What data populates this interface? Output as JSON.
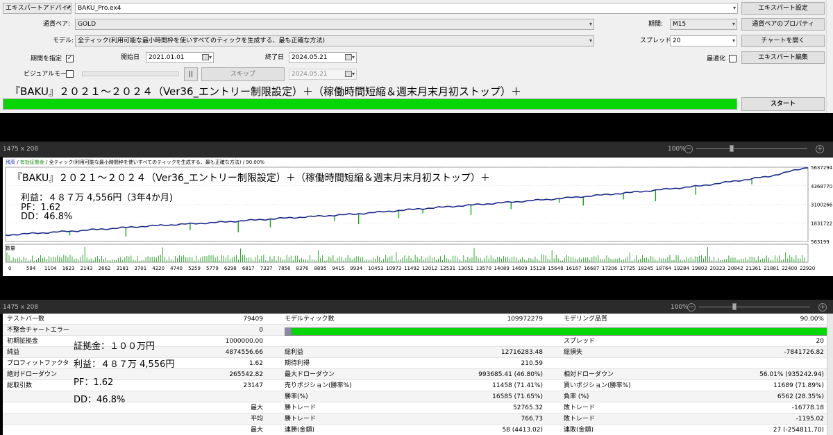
{
  "settings": {
    "expert_select": "エキスパートアドバイザ",
    "expert_file": "BAKU_Pro.ex4",
    "btn_expert_settings": "エキスパート設定",
    "symbol_label": "通貨ペア:",
    "symbol_value": "GOLD",
    "period_label": "期間:",
    "period_value": "M15",
    "btn_symbol_props": "通貨ペアのプロパティ",
    "model_label": "モデル:",
    "model_value": "全ティック(利用可能な最小時間枠を使いすべてのティックを生成する、最も正確な方法)",
    "spread_label": "スプレッド:",
    "spread_value": "20",
    "btn_open_chart": "チャートを開く",
    "use_date_label": "期間を指定",
    "use_date_checked": "✓",
    "start_label": "開始日",
    "start_value": "2021.01.01",
    "end_label": "終了日",
    "end_value": "2024.05.21",
    "optimize_label": "最適化",
    "btn_edit_expert": "エキスパート編集",
    "visual_label": "ビジュアルモード",
    "pause_btn": "||",
    "skip_btn": "スキップ",
    "skip_date": "2024.05.21",
    "headline": "『BAKU』２０２１～２０２４（Ver36_エントリー制限設定）＋（稼働時間短縮＆週末月末月初ストップ）＋",
    "progress": 1.0,
    "btn_start": "スタート"
  },
  "chart_window": {
    "size_text": "1475 x 208",
    "zoom_text": "100%",
    "minus": "−",
    "plus": "+"
  },
  "report_window": {
    "size_text": "1475 x 208",
    "zoom_text": "100%",
    "minus": "−",
    "plus": "+"
  },
  "chart_data": {
    "type": "line",
    "title_parts": {
      "balance": "残高",
      "equity": "有効証拠金",
      "desc": "全ティック(利用可能な最小時間枠を使いすべてのティックを生成する、最も正確な方法)",
      "quality": "90.00%"
    },
    "overlay_headline": "『BAKU』２０２１～２０２４（Ver36_エントリー制限設定）＋（稼働時間短縮＆週末月末月初ストップ）＋",
    "overlay_profit": "利益：４８７万 4,556円（3年4か月)",
    "overlay_pf": "PF：1.62",
    "overlay_dd": "DD：46.8%",
    "volume_label": "数量",
    "ylim": [
      563199,
      5637294
    ],
    "yticks": [
      "5637294",
      "4368770",
      "3100266",
      "1831722",
      "563199"
    ],
    "xticks": [
      "0",
      "584",
      "1104",
      "1623",
      "2143",
      "2662",
      "3181",
      "3701",
      "4220",
      "4740",
      "5259",
      "5779",
      "6298",
      "6817",
      "7337",
      "7856",
      "8376",
      "8895",
      "9415",
      "9934",
      "10453",
      "10973",
      "11492",
      "12012",
      "12531",
      "13051",
      "13570",
      "14089",
      "14609",
      "15128",
      "15648",
      "16167",
      "16687",
      "17206",
      "17725",
      "18245",
      "18764",
      "19284",
      "19803",
      "20323",
      "20842",
      "21361",
      "21881",
      "22400",
      "22920"
    ],
    "series": [
      {
        "name": "残高",
        "x": [
          0,
          2000,
          4000,
          6000,
          8000,
          10000,
          12000,
          14000,
          16000,
          18000,
          20000,
          22000,
          23147
        ],
        "y": [
          1000000,
          1280000,
          1600000,
          1850000,
          2150000,
          2420000,
          2800000,
          3150000,
          3500000,
          3900000,
          4350000,
          5000000,
          5637294
        ]
      }
    ]
  },
  "report": {
    "rows": [
      [
        "テストバー数",
        "79409",
        "モデルティック数",
        "109972279",
        "モデリング品質",
        "90.00%"
      ],
      [
        "不整合チャートエラー",
        "0",
        "",
        "",
        "",
        ""
      ],
      [
        "初期証拠金",
        "1000000.00",
        "",
        "",
        "スプレッド",
        "20"
      ],
      [
        "純益",
        "4874556.66",
        "総利益",
        "12716283.48",
        "総損失",
        "-7841726.82"
      ],
      [
        "プロフィットファクタ",
        "1.62",
        "期待利得",
        "210.59",
        "",
        ""
      ],
      [
        "絶対ドローダウン",
        "265542.82",
        "最大ドローダウン",
        "993685.41 (46.80%)",
        "相対ドローダウン",
        "56.01% (935242.94)"
      ],
      [
        "総取引数",
        "23147",
        "売りポジション(勝率%)",
        "11458 (71.41%)",
        "買いポジション(勝率%)",
        "11689 (71.89%)"
      ],
      [
        "",
        "",
        "勝率(%)",
        "16585 (71.65%)",
        "負率 (%)",
        "6562 (28.35%)"
      ],
      [
        "",
        "最大",
        "勝トレード",
        "52765.32",
        "敗トレード",
        "-16778.18"
      ],
      [
        "",
        "平均",
        "勝トレード",
        "766.73",
        "敗トレード",
        "-1195.02"
      ],
      [
        "",
        "最大",
        "連勝(金額)",
        "58 (4413.02)",
        "連敗(金額)",
        "27 (-254811.70)"
      ]
    ],
    "note_margin": "証拠金：１００万円",
    "note_profit": "利益：４８７万 4,556円",
    "note_pf": "PF：1.62",
    "note_dd": "DD：46.8%"
  },
  "colors": {
    "progress_green": "#06d606",
    "balance_line": "#1a2a8a",
    "equity_dips": "#17a317",
    "volume_bars": "#1f9a1f"
  }
}
